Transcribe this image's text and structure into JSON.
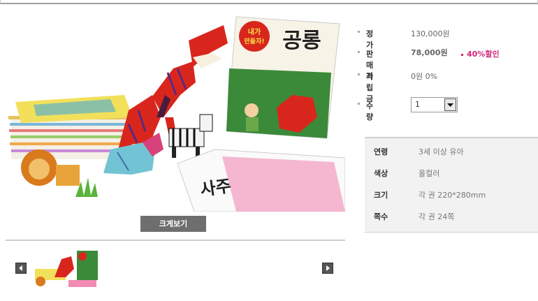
{
  "product": {
    "zoom_label": "크게보기"
  },
  "image": {
    "book_title": "공롱",
    "book_badge_line1": "내가",
    "book_badge_line2": "만들자!",
    "book2_text": "사주"
  },
  "info": {
    "list_price_label": "정가",
    "list_price_value": "130,000원",
    "sale_price_label": "판매가",
    "sale_price_value": "78,000원",
    "discount_label": "40%할인",
    "points_label": "적립금",
    "points_value": "0원 0%",
    "qty_label": "수량",
    "qty_value": "1"
  },
  "specs": [
    {
      "label": "연령",
      "value": "3세 이상 유아"
    },
    {
      "label": "색상",
      "value": "올컬러"
    },
    {
      "label": "크기",
      "value": "각 권 220*280mm"
    },
    {
      "label": "쪽수",
      "value": "각 권 24쪽"
    }
  ],
  "colors": {
    "accent": "#d4237a",
    "button_bg": "#6e6e6e",
    "spec_bg": "#f2f2f2"
  },
  "icons": {
    "prev": "chevron-left-icon",
    "next": "chevron-right-icon",
    "dropdown": "triangle-down-icon"
  }
}
